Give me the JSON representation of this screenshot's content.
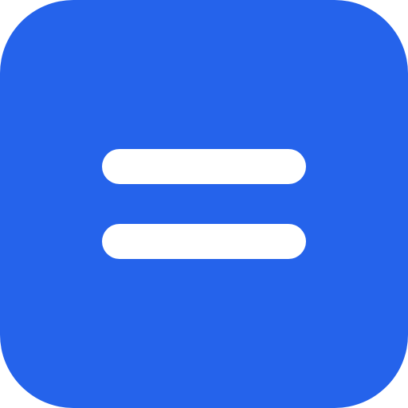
{
  "icon": {
    "name": "equals-icon",
    "background_color": "#2563EB",
    "glyph_color": "#FFFFFF"
  }
}
